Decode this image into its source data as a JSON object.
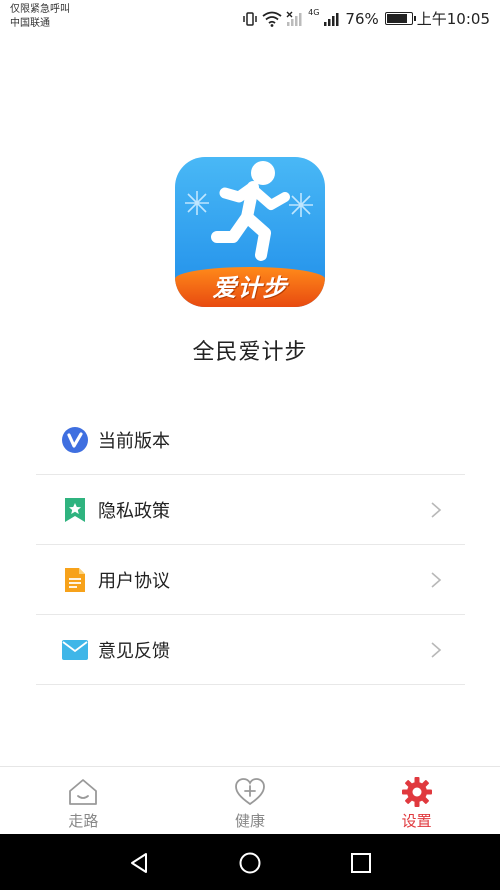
{
  "status_bar": {
    "emergency_text": "仅限紧急呼叫",
    "carrier": "中国联通",
    "battery_percent": "76%",
    "battery_level": 0.76,
    "time": "上午10:05",
    "network": "4G"
  },
  "app": {
    "logo_text": "爱计步",
    "name": "全民爱计步",
    "colors": {
      "logo_blue": "#1f8de9",
      "logo_orange": "#f07020"
    }
  },
  "menu": {
    "items": [
      {
        "label": "当前版本",
        "icon": "version-v-icon",
        "has_chevron": false
      },
      {
        "label": "隐私政策",
        "icon": "bookmark-star-icon",
        "has_chevron": true
      },
      {
        "label": "用户协议",
        "icon": "document-icon",
        "has_chevron": true
      },
      {
        "label": "意见反馈",
        "icon": "mail-icon",
        "has_chevron": true
      }
    ]
  },
  "tabbar": {
    "tabs": [
      {
        "label": "走路",
        "icon": "home-smile-icon",
        "active": false
      },
      {
        "label": "健康",
        "icon": "heart-plus-icon",
        "active": false
      },
      {
        "label": "设置",
        "icon": "gear-icon",
        "active": true
      }
    ],
    "active_color": "#e0393e"
  },
  "system_nav": {
    "buttons": [
      "back-icon",
      "home-circle-icon",
      "recents-square-icon"
    ]
  }
}
